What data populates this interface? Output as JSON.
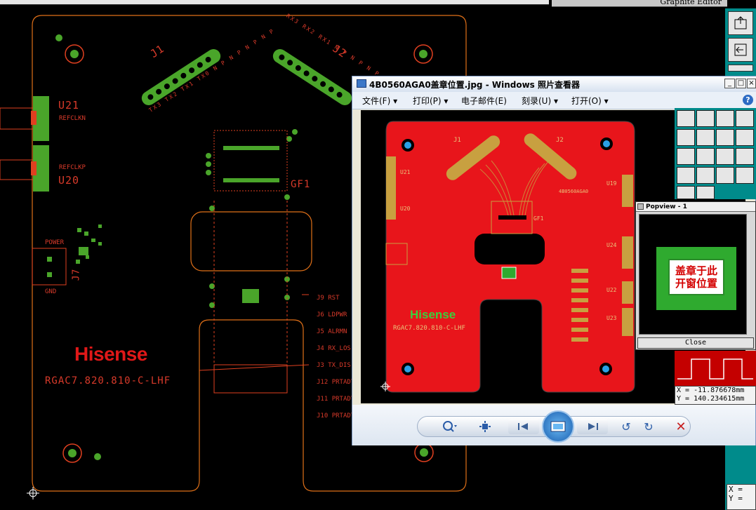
{
  "graphite_title": "Graphite Editor",
  "board": {
    "u21": "U21",
    "u21_sub": "REFCLKN",
    "u20": "U20",
    "u20_sub": "REFCLKP",
    "power": "POWER",
    "gnd": "GND",
    "j7": "J7",
    "j1": "J1",
    "j2": "J2",
    "gf1": "GF1",
    "brand": "Hisense",
    "part_no": "RGAC7.820.810-C-LHF",
    "j1_pins": [
      "TX3",
      "TX2",
      "TX1",
      "TX0",
      "N",
      "P",
      "N",
      "P",
      "N",
      "P",
      "N",
      "P"
    ],
    "j2_pins": [
      "RX3",
      "RX2",
      "RX1",
      "N",
      "P",
      "N",
      "P",
      "N",
      "P"
    ],
    "jumper_labels": [
      {
        "id": "J9",
        "name": "RST"
      },
      {
        "id": "J6",
        "name": "LDPWR"
      },
      {
        "id": "J5",
        "name": "ALRMN"
      },
      {
        "id": "J4",
        "name": "RX_LOS"
      },
      {
        "id": "J3",
        "name": "TX_DIS"
      },
      {
        "id": "J12",
        "name": "PRTADT"
      },
      {
        "id": "J11",
        "name": "PRTADT"
      },
      {
        "id": "J10",
        "name": "PRTADT"
      }
    ]
  },
  "viewer": {
    "title": "4B0560AGA0盖章位置.jpg - Windows 照片查看器",
    "menu": [
      "文件(F)",
      "打印(P)",
      "电子邮件(E)",
      "刻录(U)",
      "打开(O)"
    ],
    "help_icon": "help-icon",
    "image": {
      "brand": "Hisense",
      "part_no": "RGAC7.820.810-C-LHF",
      "u21": "U21",
      "u20": "U20",
      "u19": "U19",
      "u24": "U24",
      "u22": "U22",
      "u23": "U23",
      "gf1": "GF1",
      "j1": "J1",
      "j2": "J2",
      "code": "4B0560AGA0"
    },
    "colors": {
      "pcb": "#e8151b",
      "frame_blue": "#7a96c0"
    }
  },
  "popview": {
    "title": "Popview - 1",
    "stamp_line1": "盖章于此",
    "stamp_line2": "开窗位置",
    "close_label": "Close"
  },
  "coords": {
    "x_label": "X = -11.876678mm",
    "y_label": "Y = 140.234615mm",
    "x_short": "X =",
    "y_short": "Y ="
  },
  "colors": {
    "cad_outline": "#e07018",
    "cad_text": "#d83a2a",
    "pad_green": "#4aa52a",
    "toolbar_teal": "#008b8b"
  }
}
